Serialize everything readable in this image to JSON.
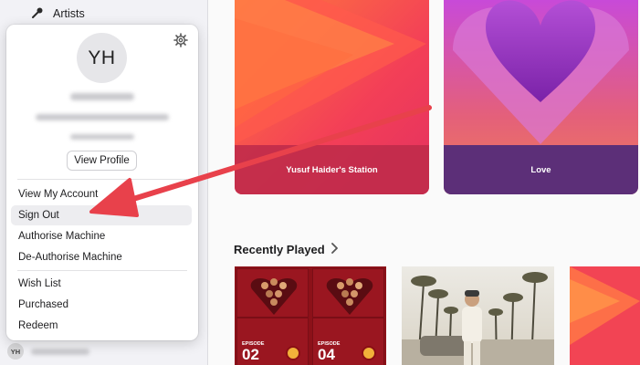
{
  "sidebar": {
    "artists_label": "Artists",
    "user_initials": "YH"
  },
  "account_popover": {
    "avatar_initials": "YH",
    "view_profile_label": "View Profile",
    "menu": [
      "View My Account",
      "Sign Out",
      "Authorise Machine",
      "De-Authorise Machine",
      "Wish List",
      "Purchased",
      "Redeem"
    ],
    "highlighted_item": "Sign Out"
  },
  "main": {
    "cards": [
      {
        "title": "Yusuf Haider's Station",
        "color": "#ee3a4a"
      },
      {
        "title": "Love",
        "color": "#7a3aa0"
      }
    ],
    "recently_played_title": "Recently Played",
    "episodes": [
      "02",
      "04"
    ],
    "episode_word": "EPISODE"
  },
  "annotation": {
    "arrow_color": "#e8414b"
  },
  "icons": [
    "microphone-icon",
    "gear-icon",
    "chevron-right-icon"
  ]
}
